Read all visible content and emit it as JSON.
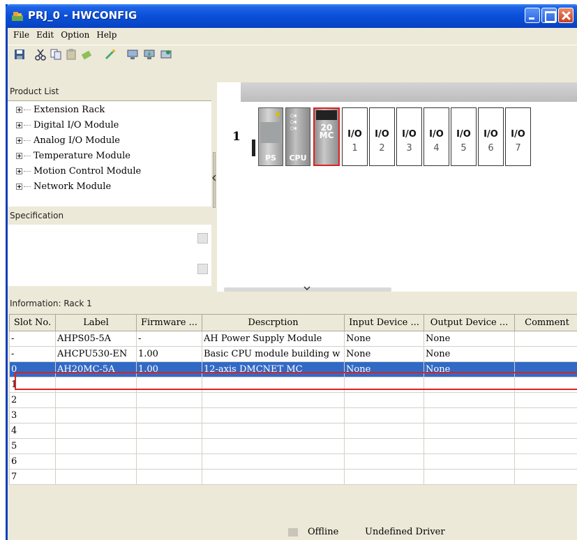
{
  "window": {
    "title": "PRJ_0 - HWCONFIG"
  },
  "menu": {
    "items": [
      "File",
      "Edit",
      "Option",
      "Help"
    ]
  },
  "toolbar": {
    "icons": [
      "save-icon",
      "cut-icon",
      "copy-icon",
      "paste-icon",
      "delete-icon",
      "wand-icon",
      "upload-icon",
      "download-icon",
      "scan-icon"
    ]
  },
  "product_list": {
    "header": "Product List",
    "items": [
      "Extension Rack",
      "Digital I/O Module",
      "Analog I/O Module",
      "Temperature Module",
      "Motion Control Module",
      "Network Module"
    ]
  },
  "specification": {
    "label": "Specification"
  },
  "rack": {
    "number": "1",
    "ps_label": "PS",
    "cpu_label": "CPU",
    "mc_label_1": "20",
    "mc_label_2": "MC",
    "io_slots": [
      {
        "label": "I/O",
        "num": "1"
      },
      {
        "label": "I/O",
        "num": "2"
      },
      {
        "label": "I/O",
        "num": "3"
      },
      {
        "label": "I/O",
        "num": "4"
      },
      {
        "label": "I/O",
        "num": "5"
      },
      {
        "label": "I/O",
        "num": "6"
      },
      {
        "label": "I/O",
        "num": "7"
      }
    ]
  },
  "info": {
    "header": "Information: Rack 1",
    "columns": [
      "Slot No.",
      "Label",
      "Firmware ...",
      "Descrption",
      "Input Device ...",
      "Output Device ...",
      "Comment"
    ],
    "rows": [
      [
        "-",
        "AHPS05-5A",
        "-",
        "AH Power Supply Module",
        "None",
        "None",
        ""
      ],
      [
        "-",
        "AHCPU530-EN",
        "1.00",
        "Basic CPU module building w",
        "None",
        "None",
        ""
      ],
      [
        "0",
        "AH20MC-5A",
        "1.00",
        "12-axis DMCNET MC",
        "None",
        "None",
        ""
      ],
      [
        "1",
        "",
        "",
        "",
        "",
        "",
        ""
      ],
      [
        "2",
        "",
        "",
        "",
        "",
        "",
        ""
      ],
      [
        "3",
        "",
        "",
        "",
        "",
        "",
        ""
      ],
      [
        "4",
        "",
        "",
        "",
        "",
        "",
        ""
      ],
      [
        "5",
        "",
        "",
        "",
        "",
        "",
        ""
      ],
      [
        "6",
        "",
        "",
        "",
        "",
        "",
        ""
      ],
      [
        "7",
        "",
        "",
        "",
        "",
        "",
        ""
      ]
    ],
    "selected_row": 2
  },
  "status": {
    "connection": "Offline",
    "driver": "Undefined Driver"
  },
  "colors": {
    "selection": "#316ac5",
    "highlight_outline": "#e02020",
    "titlebar": "#0a50d8"
  }
}
